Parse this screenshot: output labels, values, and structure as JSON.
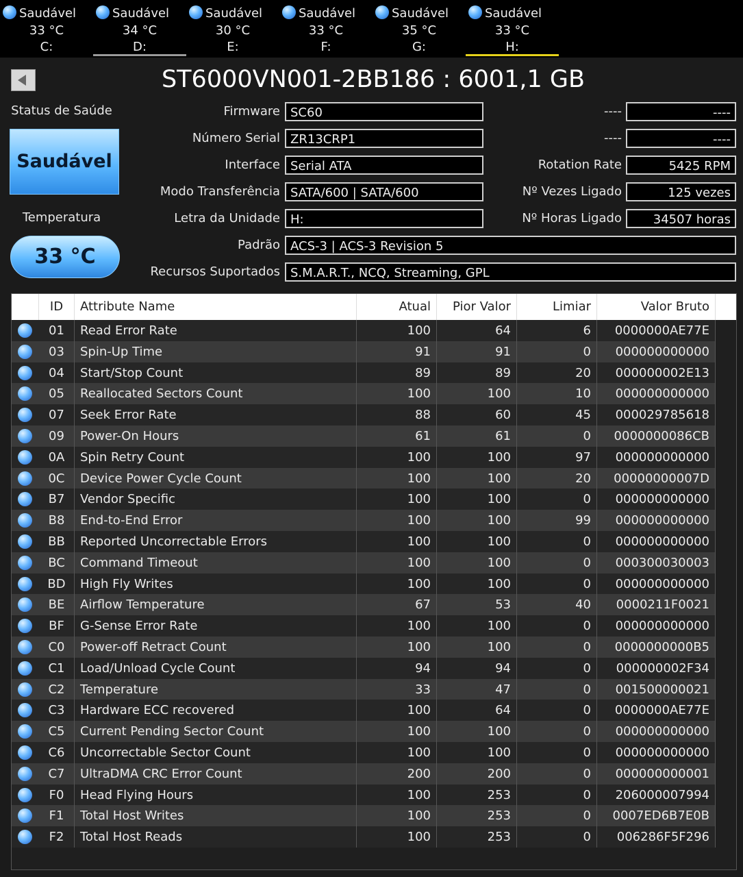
{
  "drives": [
    {
      "status": "Saudável",
      "temp": "33 °C",
      "letter": "C:"
    },
    {
      "status": "Saudável",
      "temp": "34 °C",
      "letter": "D:"
    },
    {
      "status": "Saudável",
      "temp": "30 °C",
      "letter": "E:"
    },
    {
      "status": "Saudável",
      "temp": "33 °C",
      "letter": "F:"
    },
    {
      "status": "Saudável",
      "temp": "35 °C",
      "letter": "G:"
    },
    {
      "status": "Saudável",
      "temp": "33 °C",
      "letter": "H:"
    }
  ],
  "colors": {
    "selected_tab_underline": "#e6d21a",
    "hover_tab_underline": "#9a9a9a",
    "health_blue": "#5cb8ff"
  },
  "header": {
    "title": "ST6000VN001-2BB186 : 6001,1 GB"
  },
  "health": {
    "label": "Status de Saúde",
    "value": "Saudável"
  },
  "temperature": {
    "label": "Temperatura",
    "value": "33 °C"
  },
  "info": {
    "firmware_label": "Firmware",
    "firmware": "SC60",
    "serial_label": "Número Serial",
    "serial": "ZR13CRP1",
    "interface_label": "Interface",
    "interface": "Serial ATA",
    "transfer_label": "Modo Transferência",
    "transfer": "SATA/600 | SATA/600",
    "letter_label": "Letra da Unidade",
    "letter": "H:",
    "standard_label": "Padrão",
    "standard": "ACS-3 | ACS-3 Revision 5",
    "features_label": "Recursos Suportados",
    "features": "S.M.A.R.T., NCQ, Streaming, GPL",
    "r1_label": "----",
    "r1_value": "----",
    "r2_label": "----",
    "r2_value": "----",
    "rotation_label": "Rotation Rate",
    "rotation": "5425 RPM",
    "power_count_label": "Nº Vezes Ligado",
    "power_count": "125 vezes",
    "power_hours_label": "Nº Horas Ligado",
    "power_hours": "34507 horas"
  },
  "table": {
    "headers": {
      "id": "ID",
      "name": "Attribute Name",
      "current": "Atual",
      "worst": "Pior Valor",
      "threshold": "Limiar",
      "raw": "Valor Bruto"
    },
    "rows": [
      {
        "id": "01",
        "name": "Read Error Rate",
        "current": "100",
        "worst": "64",
        "threshold": "6",
        "raw": "0000000AE77E"
      },
      {
        "id": "03",
        "name": "Spin-Up Time",
        "current": "91",
        "worst": "91",
        "threshold": "0",
        "raw": "000000000000"
      },
      {
        "id": "04",
        "name": "Start/Stop Count",
        "current": "89",
        "worst": "89",
        "threshold": "20",
        "raw": "000000002E13"
      },
      {
        "id": "05",
        "name": "Reallocated Sectors Count",
        "current": "100",
        "worst": "100",
        "threshold": "10",
        "raw": "000000000000"
      },
      {
        "id": "07",
        "name": "Seek Error Rate",
        "current": "88",
        "worst": "60",
        "threshold": "45",
        "raw": "000029785618"
      },
      {
        "id": "09",
        "name": "Power-On Hours",
        "current": "61",
        "worst": "61",
        "threshold": "0",
        "raw": "0000000086CB"
      },
      {
        "id": "0A",
        "name": "Spin Retry Count",
        "current": "100",
        "worst": "100",
        "threshold": "97",
        "raw": "000000000000"
      },
      {
        "id": "0C",
        "name": "Device Power Cycle Count",
        "current": "100",
        "worst": "100",
        "threshold": "20",
        "raw": "00000000007D"
      },
      {
        "id": "B7",
        "name": "Vendor Specific",
        "current": "100",
        "worst": "100",
        "threshold": "0",
        "raw": "000000000000"
      },
      {
        "id": "B8",
        "name": "End-to-End Error",
        "current": "100",
        "worst": "100",
        "threshold": "99",
        "raw": "000000000000"
      },
      {
        "id": "BB",
        "name": "Reported Uncorrectable Errors",
        "current": "100",
        "worst": "100",
        "threshold": "0",
        "raw": "000000000000"
      },
      {
        "id": "BC",
        "name": "Command Timeout",
        "current": "100",
        "worst": "100",
        "threshold": "0",
        "raw": "000300030003"
      },
      {
        "id": "BD",
        "name": "High Fly Writes",
        "current": "100",
        "worst": "100",
        "threshold": "0",
        "raw": "000000000000"
      },
      {
        "id": "BE",
        "name": "Airflow Temperature",
        "current": "67",
        "worst": "53",
        "threshold": "40",
        "raw": "0000211F0021"
      },
      {
        "id": "BF",
        "name": "G-Sense Error Rate",
        "current": "100",
        "worst": "100",
        "threshold": "0",
        "raw": "000000000000"
      },
      {
        "id": "C0",
        "name": "Power-off Retract Count",
        "current": "100",
        "worst": "100",
        "threshold": "0",
        "raw": "0000000000B5"
      },
      {
        "id": "C1",
        "name": "Load/Unload Cycle Count",
        "current": "94",
        "worst": "94",
        "threshold": "0",
        "raw": "000000002F34"
      },
      {
        "id": "C2",
        "name": "Temperature",
        "current": "33",
        "worst": "47",
        "threshold": "0",
        "raw": "001500000021"
      },
      {
        "id": "C3",
        "name": "Hardware ECC recovered",
        "current": "100",
        "worst": "64",
        "threshold": "0",
        "raw": "0000000AE77E"
      },
      {
        "id": "C5",
        "name": "Current Pending Sector Count",
        "current": "100",
        "worst": "100",
        "threshold": "0",
        "raw": "000000000000"
      },
      {
        "id": "C6",
        "name": "Uncorrectable Sector Count",
        "current": "100",
        "worst": "100",
        "threshold": "0",
        "raw": "000000000000"
      },
      {
        "id": "C7",
        "name": "UltraDMA CRC Error Count",
        "current": "200",
        "worst": "200",
        "threshold": "0",
        "raw": "000000000001"
      },
      {
        "id": "F0",
        "name": "Head Flying Hours",
        "current": "100",
        "worst": "253",
        "threshold": "0",
        "raw": "206000007994"
      },
      {
        "id": "F1",
        "name": "Total Host Writes",
        "current": "100",
        "worst": "253",
        "threshold": "0",
        "raw": "0007ED6B7E0B"
      },
      {
        "id": "F2",
        "name": "Total Host Reads",
        "current": "100",
        "worst": "253",
        "threshold": "0",
        "raw": "006286F5F296"
      }
    ]
  }
}
